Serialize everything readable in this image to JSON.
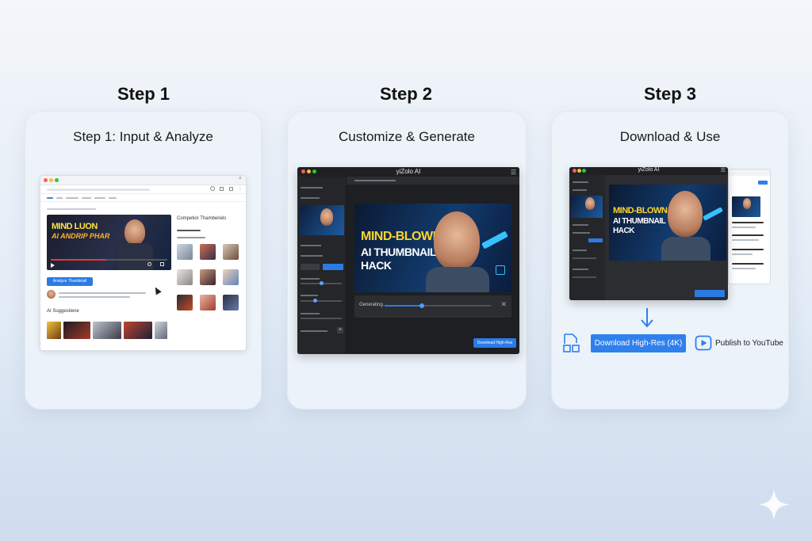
{
  "steps": [
    {
      "heading": "Step 1",
      "title": "Step 1: Input & Analyze"
    },
    {
      "heading": "Step 2",
      "title": "Customize & Generate"
    },
    {
      "heading": "Step 3",
      "title": "Download & Use"
    }
  ],
  "card1": {
    "thumb_line1": "MIND LUON",
    "thumb_line2": "AI ANDRIP PHAR",
    "analyze_button": "Analyze Thumbnail",
    "competitor_title": "Competior Thamberiels",
    "section_label": "AI Suggestiene"
  },
  "card2": {
    "app_title": "yiZolo AI",
    "hero_line1": "MIND-BLOWN",
    "hero_line2": "AI THUMBNAIL",
    "hero_line3": "HACK",
    "progress_label": "Generating...",
    "download_button": "Download High-Res",
    "slider_level": 0.35
  },
  "card3": {
    "app_title": "yiZolo AI",
    "hero_line1": "MIND-BLOWN",
    "hero_line2": "AI THUMBNAIL",
    "hero_line3": "HACK",
    "download_hires": "Download High-Res (4K)",
    "publish_label": "Publish to YouTube"
  },
  "colors": {
    "accent": "#2f80ed",
    "hero_yellow": "#ffd52e",
    "arrow_cyan": "#36c2ff",
    "editor_bg": "#2b2d31"
  }
}
